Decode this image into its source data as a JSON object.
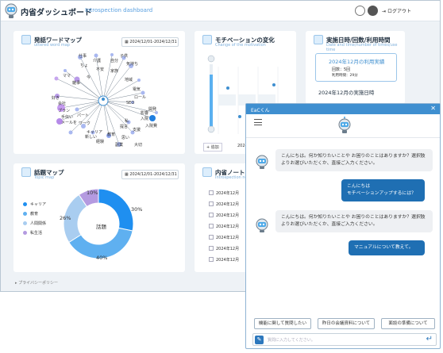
{
  "app": {
    "title": "内省ダッシュボード",
    "subtitle": "Introspection dashboard",
    "logout_label": "ログアウト",
    "footer_link": "▸ プライバシーポリシー"
  },
  "word_map": {
    "title": "発話ワードマップ",
    "subtitle": "uttered word map",
    "date_range": "2024/12/01-2024/12/31",
    "words": [
      "仕事",
      "介護",
      "自分",
      "子供",
      "気持ち",
      "ちょ",
      "ママ",
      "雑事",
      "家族",
      "不安",
      "今",
      "地域",
      "好き",
      "会社",
      "プラン",
      "ロール",
      "手伝い",
      "電気",
      "パート",
      "ワーク",
      "メールを",
      "キャリア",
      "新しい",
      "経験",
      "SEO",
      "教育",
      "思い",
      "私",
      "提言",
      "支援",
      "影響",
      "大切",
      "開発",
      "副業",
      "入院",
      "入院費"
    ]
  },
  "motivation": {
    "title": "モチベーションの変化",
    "subtitle": "Change of the motivation",
    "year_label": "2024",
    "add_label": "+ 追加"
  },
  "usage": {
    "title": "実施日時/回数/利用時間",
    "subtitle": "Date and time/number of times/use time",
    "month_label": "2024年12月の利用実績",
    "count_line": "回数：5回",
    "time_line": "利用時間：29分",
    "days_label": "2024年12月の実施日時"
  },
  "topic_map": {
    "title": "話題マップ",
    "subtitle": "Topic map",
    "date_range": "2024/12/01-2024/12/31",
    "center_label": "話題",
    "legend": [
      {
        "label": "キャリア",
        "color": "#1f8ff0"
      },
      {
        "label": "教育",
        "color": "#5fb0f0"
      },
      {
        "label": "人間関係",
        "color": "#a9cdf0"
      },
      {
        "label": "私生活",
        "color": "#b49ae0"
      }
    ]
  },
  "chart_data": {
    "type": "pie",
    "title": "話題マップ",
    "categories": [
      "キャリア",
      "教育",
      "人間関係",
      "私生活"
    ],
    "values": [
      30,
      40,
      26,
      10
    ],
    "value_labels": [
      "30%",
      "40%",
      "26%",
      "10%"
    ]
  },
  "journal": {
    "title": "内省ノート",
    "subtitle": "Introspection note",
    "entries": [
      "2024年12月",
      "2024年12月",
      "2024年12月",
      "2024年12月",
      "2024年12月",
      "2024年12月",
      "2024年12月"
    ]
  },
  "chat": {
    "window_title": "EaCくん",
    "close_label": "✕",
    "messages": [
      {
        "from": "bot",
        "text": "こんにちは。何か知りたいことや お困りのことはありますか？選択肢よりお選びいただくか、直接ご入力ください。"
      },
      {
        "from": "user",
        "text": "こんにちは\nモチベーションアップするには？"
      },
      {
        "from": "bot",
        "text": "こんにちは。何か知りたいことや お困りのことはありますか？選択肢よりお選びいただくか、直接ご入力ください。"
      },
      {
        "from": "user",
        "text": "マニュアルについて教えて。"
      }
    ],
    "suggestions": [
      "機能に関して質問したい",
      "昨日の会議資料について",
      "面談の準備について"
    ],
    "input_placeholder": "質問に入力してください。"
  }
}
